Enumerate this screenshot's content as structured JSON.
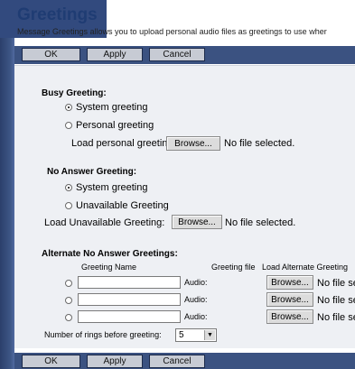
{
  "page": {
    "title": "Greetings",
    "description": "Message Greetings allows you to upload personal audio files as greetings to use wher"
  },
  "toolbar": {
    "ok": "OK",
    "apply": "Apply",
    "cancel": "Cancel"
  },
  "busy": {
    "heading": "Busy Greeting:",
    "system_option": "System greeting",
    "personal_option": "Personal greeting",
    "selected": "system",
    "load_label": "Load personal greeting:",
    "browse": "Browse...",
    "file_status": "No file selected."
  },
  "no_answer": {
    "heading": "No Answer Greeting:",
    "system_option": "System greeting",
    "unavailable_option": "Unavailable Greeting",
    "selected": "system",
    "load_label": "Load Unavailable Greeting:",
    "browse": "Browse...",
    "file_status": "No file selected."
  },
  "alternate": {
    "heading": "Alternate No Answer Greetings:",
    "col_name": "Greeting Name",
    "col_file": "Greeting file",
    "col_load": "Load Alternate Greeting",
    "rows": [
      {
        "name": "",
        "audio_label": "Audio:",
        "browse": "Browse...",
        "file_status": "No file se"
      },
      {
        "name": "",
        "audio_label": "Audio:",
        "browse": "Browse...",
        "file_status": "No file se"
      },
      {
        "name": "",
        "audio_label": "Audio:",
        "browse": "Browse...",
        "file_status": "No file se"
      }
    ]
  },
  "rings": {
    "label": "Number of rings before greeting:",
    "value": "5",
    "arrow_icon": "triangle-down"
  }
}
